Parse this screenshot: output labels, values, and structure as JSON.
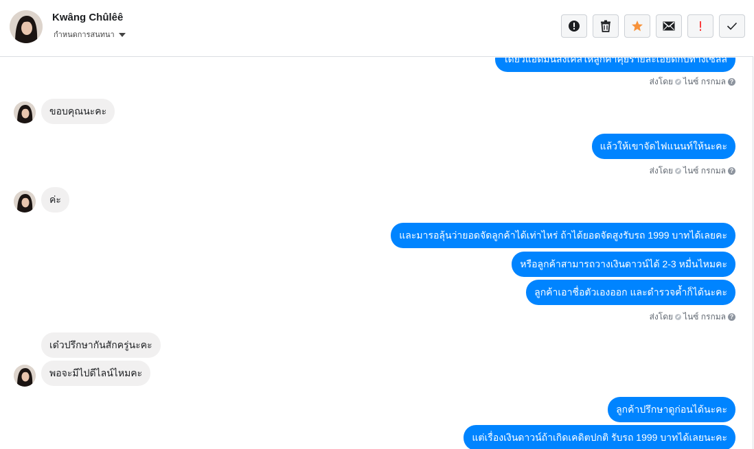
{
  "header": {
    "contact_name": "Kwâng Chûlêê",
    "subtitle": "กำหนดการสนทนา",
    "toolbar": [
      {
        "icon": "alert-circle-icon",
        "color": "#1c1e21"
      },
      {
        "icon": "trash-icon",
        "color": "#1c1e21"
      },
      {
        "icon": "star-icon",
        "color": "#f7923a"
      },
      {
        "icon": "envelope-icon",
        "color": "#1c1e21"
      },
      {
        "icon": "exclamation-icon",
        "color": "#fa3e3e"
      },
      {
        "icon": "check-icon",
        "color": "#1c1e21"
      }
    ]
  },
  "colors": {
    "outgoing": "#0084ff",
    "incoming": "#f1f0f0"
  },
  "messages": {
    "out_0": "ได้ยวแอดมินส่งเคสให้ลูกค้าคุยรายละเอียดกับทางเซลล์",
    "in_1": "ขอบคุณนะคะ",
    "out_2": "แล้วให้เขาจัดไฟแนนท์ให้นะคะ",
    "in_3": "ค่ะ",
    "out_4": "และมารอลุ้นว่ายอดจัดลูกค้าได้เท่าไหร่ ถ้าได้ยอดจัดสูงรับรถ 1999 บาทได้เลยคะ",
    "out_5": "หรือลูกค้าสามารถวางเงินดาวน์ได้ 2-3 หมื่นไหมคะ",
    "out_6": "ลูกค้าเอาชื่อตัวเองออก และดำรวจค้ำก็ได้นะคะ",
    "in_7": "เด๋วปรึกษากันสักครู่นะคะ",
    "in_8": "พอจะมีไปดีไลน์ไหมคะ",
    "out_9": "ลูกค้าปรึกษาดูก่อนได้นะคะ",
    "out_10": "แต่เรื่องเงินดาวน์ถ้าเกิดเคดิตปกติ รับรถ 1999 บาทได้เลยนะคะ"
  },
  "status": {
    "sent_by": "ส่งโดย",
    "sender": "ไนซ์ กรกมล",
    "help": "?"
  }
}
